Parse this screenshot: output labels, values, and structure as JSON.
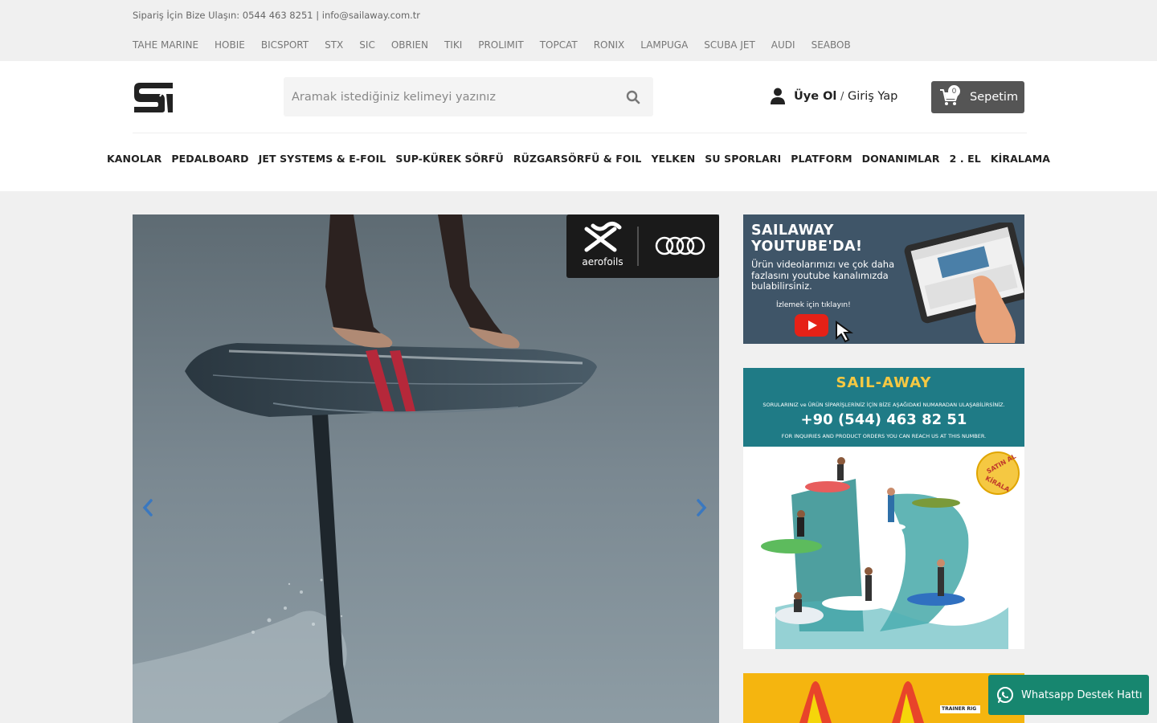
{
  "topbar": {
    "contact": "Sipariş İçin Bize Ulaşın: 0544 463 8251 | info@sailaway.com.tr",
    "brands": [
      "TAHE MARINE",
      "HOBIE",
      "BICSPORT",
      "STX",
      "SIC",
      "OBRIEN",
      "TIKI",
      "PROLIMIT",
      "TOPCAT",
      "RONIX",
      "LAMPUGA",
      "SCUBA JET",
      "AUDI",
      "SEABOB"
    ]
  },
  "header": {
    "search_placeholder": "Aramak istediğiniz kelimeyi yazınız",
    "user_register": "Üye Ol",
    "user_separator": "/",
    "user_login": "Giriş Yap",
    "cart_label": "Sepetim",
    "cart_count": "0"
  },
  "nav": [
    "KANOLAR",
    "PEDALBOARD",
    "JET SYSTEMS & E-FOIL",
    "SUP-KÜREK SÖRFÜ",
    "RÜZGARSÖRFÜ & FOIL",
    "YELKEN",
    "SU SPORLARI",
    "PLATFORM",
    "DONANIMLAR",
    "2 . EL",
    "KİRALAMA"
  ],
  "hero": {
    "brand_logo": "aerofoils",
    "prev_icon": "chevron-left-icon",
    "next_icon": "chevron-right-icon"
  },
  "youtube_banner": {
    "title_line1": "SAILAWAY",
    "title_line2": "YOUTUBE'DA!",
    "text": "Ürün videolarımızı ve çok daha fazlasını youtube kanalımızda bulabilirsiniz.",
    "cta": "İzlemek için tıklayın!"
  },
  "contact_banner": {
    "logo": "SAIL-AWAY",
    "line1": "SORULARINIZ ve ÜRÜN SİPARİŞLERİNİZ İÇİN BİZE AŞAĞIDAKİ NUMARADAN ULAŞABİLİRSİNİZ.",
    "phone": "+90 (544) 463 82 51",
    "line2": "FOR INQUIRIES AND PRODUCT ORDERS YOU CAN REACH US AT THIS NUMBER.",
    "badge_top": "SATIN AL",
    "badge_bottom": "KİRALA"
  },
  "third_banner": {
    "tag": "TRAINER RIG"
  },
  "whatsapp": {
    "label": "Whatsapp Destek Hattı"
  },
  "colors": {
    "cart_bg": "#555555",
    "whatsapp_bg": "#17866f",
    "contact_banner_bg": "#1f7b86",
    "youtube_banner_bg": "#3f5568",
    "accent_yellow": "#f5c842"
  }
}
